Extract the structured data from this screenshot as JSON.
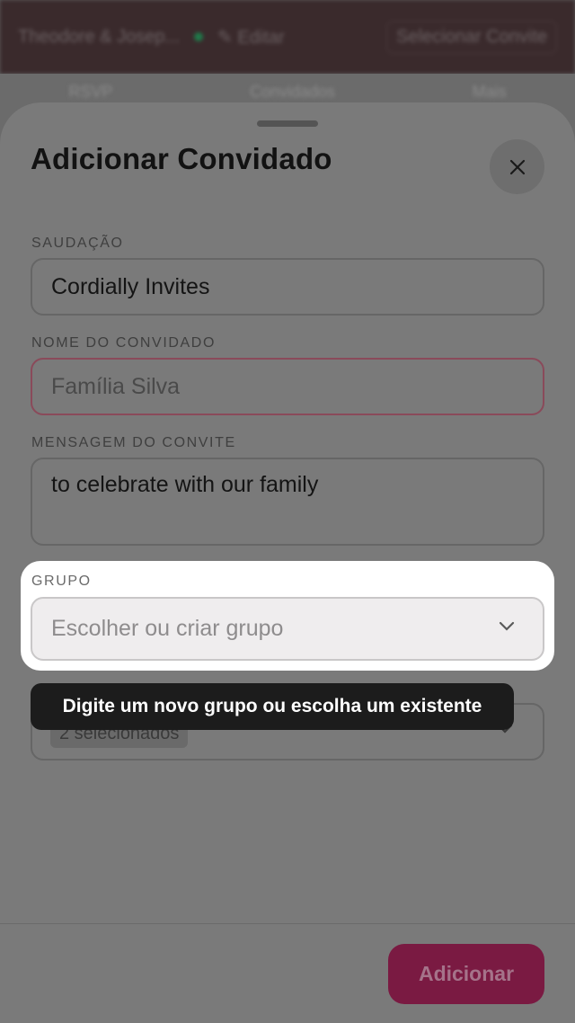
{
  "background": {
    "topbar": {
      "event_name": "Theodore & Josep...",
      "edit_label": "✎ Editar",
      "selector_label": "Selecionar Convite"
    },
    "tabs": [
      "RSVP",
      "Convidados",
      "Mais"
    ]
  },
  "sheet": {
    "title": "Adicionar Convidado",
    "close_icon": "close-icon",
    "fields": {
      "salutation": {
        "label": "SAUDAÇÃO",
        "value": "Cordially Invites"
      },
      "guest_name": {
        "label": "NOME DO CONVIDADO",
        "placeholder": "Família Silva",
        "status": "error"
      },
      "invite_message": {
        "label": "MENSAGEM DO CONVITE",
        "value": "to celebrate with our family"
      },
      "group": {
        "label": "GRUPO",
        "placeholder": "Escolher ou criar grupo",
        "icon": "chevron-down-icon"
      },
      "events": {
        "chip_label": "2 selecionados",
        "icon": "chevron-down-icon"
      }
    },
    "submit_label": "Adicionar"
  },
  "tooltip": {
    "text": "Digite um novo grupo ou escolha um existente"
  },
  "colors": {
    "accent": "#c2185b",
    "overlay": "#000000",
    "tooltip_bg": "#1c1c1c",
    "error_border": "#e57a9a"
  }
}
